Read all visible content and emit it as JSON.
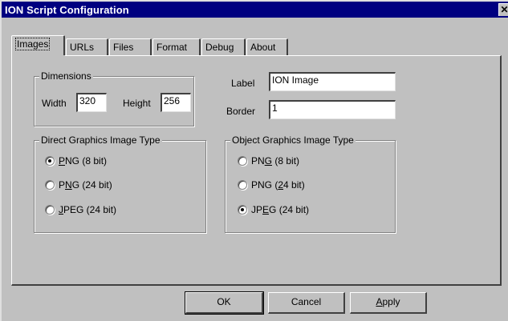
{
  "window": {
    "title": "ION Script Configuration",
    "close_glyph": "✕"
  },
  "tabs": [
    {
      "label": "Images",
      "active": true
    },
    {
      "label": "URLs",
      "active": false
    },
    {
      "label": "Files",
      "active": false
    },
    {
      "label": "Format",
      "active": false
    },
    {
      "label": "Debug",
      "active": false
    },
    {
      "label": "About",
      "active": false
    }
  ],
  "dimensions": {
    "legend": "Dimensions",
    "width_label": "Width",
    "width_value": "320",
    "height_label": "Height",
    "height_value": "256"
  },
  "image_props": {
    "label_label": "Label",
    "label_value": "ION Image",
    "border_label": "Border",
    "border_value": "1"
  },
  "direct_graphics": {
    "legend": "Direct Graphics Image Type",
    "options": [
      {
        "pre": "",
        "key": "P",
        "post": "NG (8 bit)",
        "selected": true
      },
      {
        "pre": "P",
        "key": "N",
        "post": "G (24 bit)",
        "selected": false
      },
      {
        "pre": "",
        "key": "J",
        "post": "PEG (24 bit)",
        "selected": false
      }
    ]
  },
  "object_graphics": {
    "legend": "Object Graphics Image Type",
    "options": [
      {
        "pre": "PN",
        "key": "G",
        "post": " (8 bit)",
        "selected": false
      },
      {
        "pre": "PNG (",
        "key": "2",
        "post": "4 bit)",
        "selected": false
      },
      {
        "pre": "JP",
        "key": "E",
        "post": "G (24 bit)",
        "selected": true
      }
    ]
  },
  "buttons": {
    "ok": "OK",
    "cancel": "Cancel",
    "apply_key": "A",
    "apply_rest": "pply"
  }
}
